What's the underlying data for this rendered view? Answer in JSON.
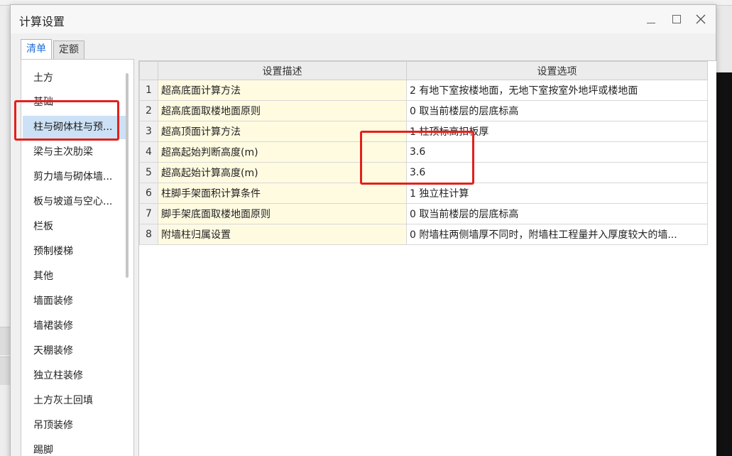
{
  "dialog": {
    "title": "计算设置",
    "tabs": [
      {
        "label": "清单",
        "active": true
      },
      {
        "label": "定额",
        "active": false
      }
    ]
  },
  "left_list": {
    "items": [
      "土方",
      "基础",
      "柱与砌体柱与预...",
      "梁与主次肋梁",
      "剪力墙与砌体墙...",
      "板与坡道与空心...",
      "栏板",
      "预制楼梯",
      "其他",
      "墙面装修",
      "墙裙装修",
      "天棚装修",
      "独立柱装修",
      "土方灰土回填",
      "吊顶装修",
      "踢脚"
    ],
    "selected_index": 2
  },
  "grid": {
    "headers": [
      "设置描述",
      "设置选项"
    ],
    "rows": [
      {
        "num": "1",
        "desc": "超高底面计算方法",
        "option": "2 有地下室按楼地面，无地下室按室外地坪或楼地面"
      },
      {
        "num": "2",
        "desc": "超高底面取楼地面原则",
        "option": "0 取当前楼层的层底标高"
      },
      {
        "num": "3",
        "desc": "超高顶面计算方法",
        "option": "1 柱顶标高扣板厚"
      },
      {
        "num": "4",
        "desc": "超高起始判断高度(m)",
        "option": "3.6"
      },
      {
        "num": "5",
        "desc": "超高起始计算高度(m)",
        "option": "3.6"
      },
      {
        "num": "6",
        "desc": "柱脚手架面积计算条件",
        "option": "1 独立柱计算"
      },
      {
        "num": "7",
        "desc": "脚手架底面取楼地面原则",
        "option": "0 取当前楼层的层底标高"
      },
      {
        "num": "8",
        "desc": "附墙柱归属设置",
        "option": "0 附墙柱两侧墙厚不同时，附墙柱工程量并入厚度较大的墙..."
      }
    ]
  },
  "colors": {
    "highlight": "#e3201b",
    "selected_row": "#cce1f5",
    "desc_cell": "#fffbe1",
    "active_tab_text": "#1e6fd9"
  }
}
